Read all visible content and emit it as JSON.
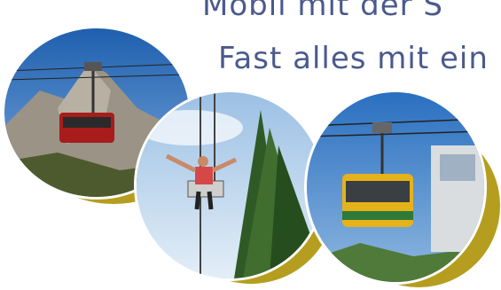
{
  "headline": "Mobil mit der S",
  "subline": "Fast alles mit ein",
  "colors": {
    "text": "#4a5a8c",
    "accent_gold": "#b59e1f",
    "sky_blue": "#2a6fc0"
  },
  "photos": [
    {
      "name": "gondola-mountain-photo",
      "subject": "red gondola cable car in front of rocky mountain"
    },
    {
      "name": "chairlift-photo",
      "subject": "person with arms raised on chairlift beside fir tree"
    },
    {
      "name": "yellow-gondola-photo",
      "subject": "yellow gondola cable car near station"
    }
  ]
}
